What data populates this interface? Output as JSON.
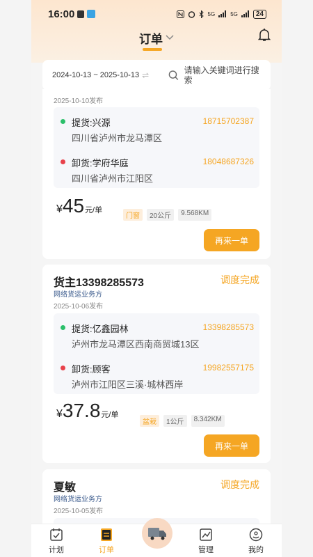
{
  "status": {
    "time": "16:00",
    "network": "5G",
    "network2": "5G",
    "battery": "24"
  },
  "header": {
    "title": "订单"
  },
  "search": {
    "date_range": "2024-10-13 ~ 2025-10-13",
    "placeholder": "请输入关键词进行搜索"
  },
  "cards": [
    {
      "published": "2025-10-10发布",
      "pickup": {
        "label": "提货:兴源",
        "phone": "18715702387",
        "address": "四川省泸州市龙马潭区"
      },
      "unload": {
        "label": "卸货:学府华庭",
        "phone": "18048687326",
        "address": "四川省泸州市江阳区"
      },
      "price": "45",
      "currency": "¥",
      "unit": "元/单",
      "tags": [
        "门窗",
        "20公斤",
        "9.568KM"
      ],
      "button": "再来一单"
    },
    {
      "shipper": "货主13398285573",
      "state": "调度完成",
      "service": "网络货运业务方",
      "published": "2025-10-06发布",
      "pickup": {
        "label": "提货:亿鑫园林",
        "phone": "13398285573",
        "address": "泸州市龙马潭区西南商贸城13区"
      },
      "unload": {
        "label": "卸货:顾客",
        "phone": "19982557175",
        "address": "泸州市江阳区三溪·城林西岸"
      },
      "price": "37.8",
      "currency": "¥",
      "unit": "元/单",
      "tags": [
        "盆栽",
        "1公斤",
        "8.342KM"
      ],
      "button": "再来一单"
    },
    {
      "shipper": "夏敏",
      "state": "调度完成",
      "service": "网络货运业务方",
      "published": "2025-10-05发布"
    }
  ],
  "tabs": [
    {
      "label": "计划"
    },
    {
      "label": "订单"
    },
    {
      "label": "管理"
    },
    {
      "label": "我的"
    }
  ],
  "colors": {
    "accent": "#f5a623",
    "pickup_dot": "#2bbf6a",
    "unload_dot": "#e8414a"
  }
}
